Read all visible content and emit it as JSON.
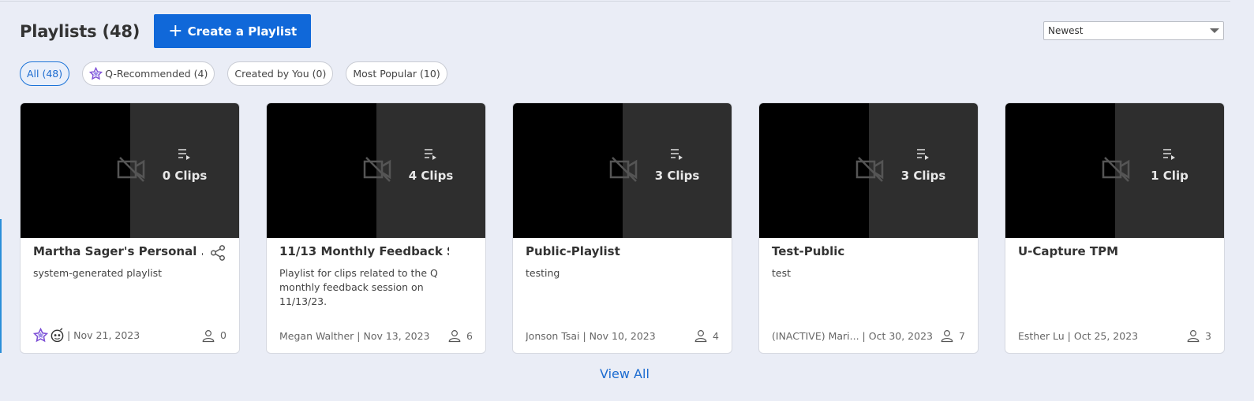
{
  "header": {
    "title": "Playlists (48)",
    "create_label": "Create a Playlist"
  },
  "sort": {
    "selected": "Newest"
  },
  "filters": [
    {
      "label": "All (48)",
      "active": true
    },
    {
      "label": "Q-Recommended (4)",
      "icon": "star-icon"
    },
    {
      "label": "Created by You (0)"
    },
    {
      "label": "Most Popular (10)"
    }
  ],
  "cards": [
    {
      "clips": "0 Clips",
      "title": "Martha Sager's Personal ...",
      "desc": "system-generated playlist",
      "meta": "| Nov 21, 2023",
      "count": "0"
    },
    {
      "clips": "4 Clips",
      "title": "11/13 Monthly Feedback S...",
      "desc": "Playlist for clips related to the Q monthly feedback session on 11/13/23.",
      "meta": "Megan Walther | Nov 13, 2023",
      "count": "6"
    },
    {
      "clips": "3 Clips",
      "title": "Public-Playlist",
      "desc": "testing",
      "meta": "Jonson Tsai | Nov 10, 2023",
      "count": "4"
    },
    {
      "clips": "3 Clips",
      "title": "Test-Public",
      "desc": "test",
      "meta": "(INACTIVE) Mari...  | Oct 30, 2023",
      "count": "7"
    },
    {
      "clips": "1 Clip",
      "title": "U-Capture TPM",
      "desc": "",
      "meta": "Esther Lu | Oct 25, 2023",
      "count": "3"
    }
  ],
  "view_all_label": "View All",
  "colors": {
    "accent": "#1068d9",
    "background": "#eaedf6",
    "star": "#7d4fd6"
  }
}
